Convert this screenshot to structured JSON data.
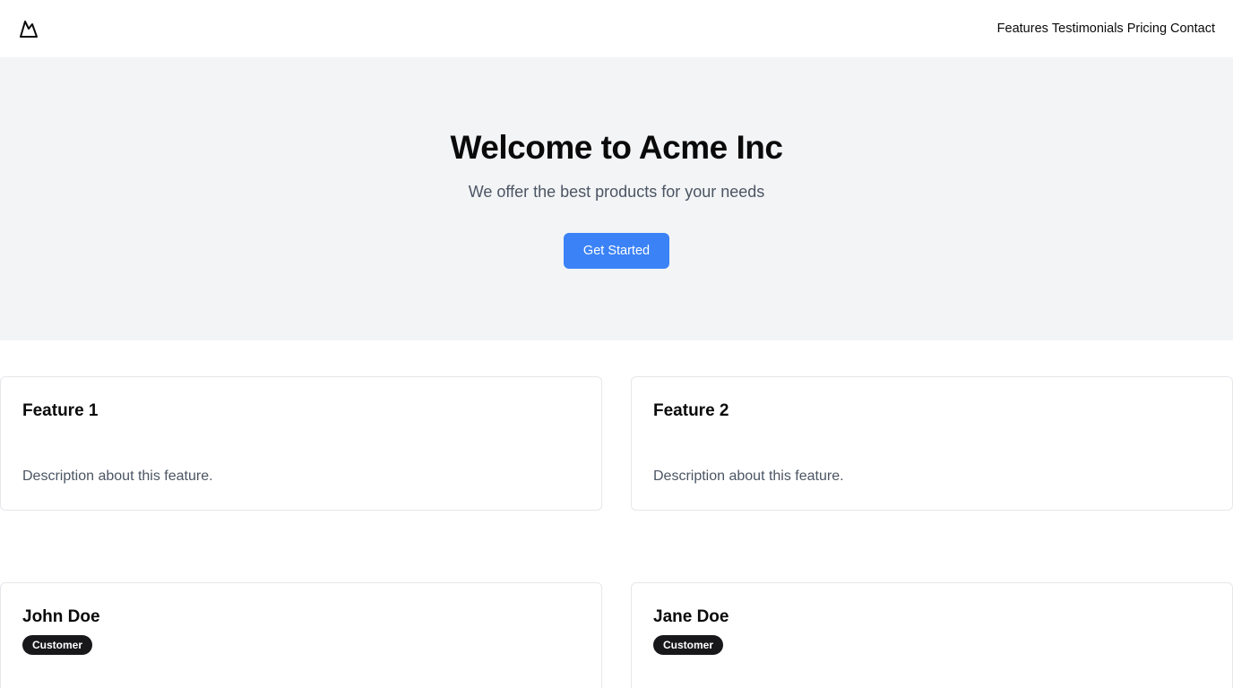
{
  "header": {
    "logo_icon": "mountain-icon",
    "nav": [
      {
        "label": "Features"
      },
      {
        "label": "Testimonials"
      },
      {
        "label": "Pricing"
      },
      {
        "label": "Contact"
      }
    ]
  },
  "hero": {
    "title": "Welcome to Acme Inc",
    "subtitle": "We offer the best products for your needs",
    "cta_label": "Get Started",
    "cta_color": "#3b82f6",
    "background": "#f3f4f6"
  },
  "features": [
    {
      "title": "Feature 1",
      "description": "Description about this feature."
    },
    {
      "title": "Feature 2",
      "description": "Description about this feature."
    }
  ],
  "testimonials": [
    {
      "name": "John Doe",
      "badge": "Customer"
    },
    {
      "name": "Jane Doe",
      "badge": "Customer"
    }
  ]
}
